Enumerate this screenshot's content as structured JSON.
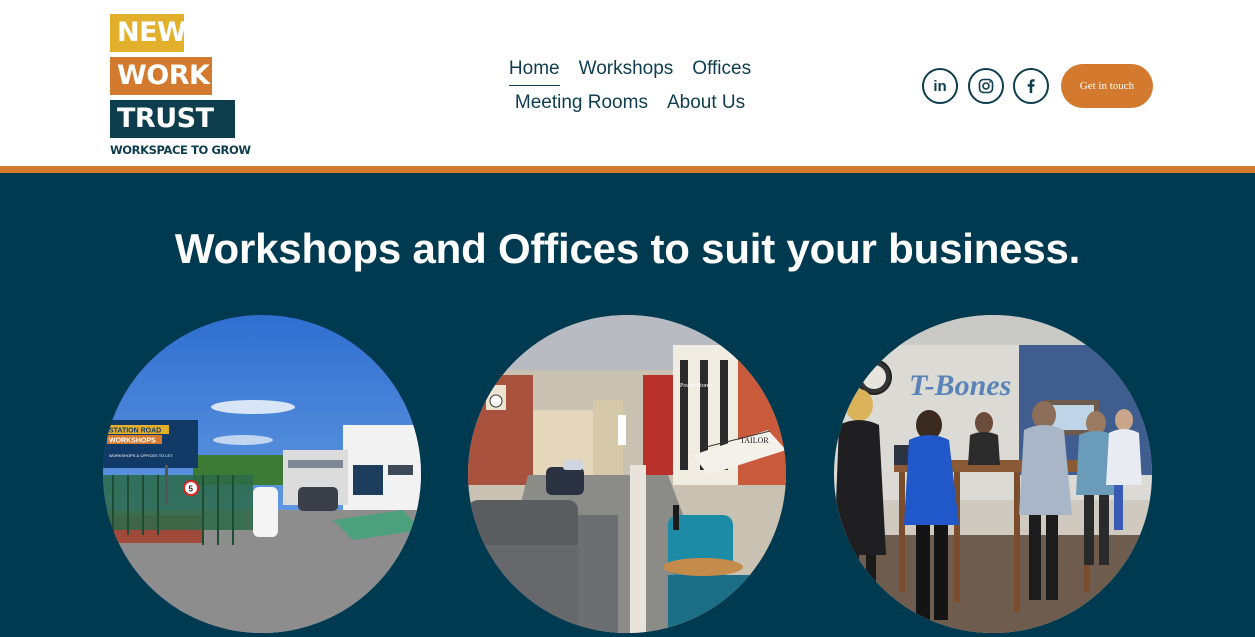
{
  "logo": {
    "line1": "NEW",
    "line2": "WORK",
    "line3": "TRUST",
    "tagline": "WORKSPACE TO GROW"
  },
  "nav": {
    "items": [
      {
        "label": "Home",
        "active": true
      },
      {
        "label": "Workshops"
      },
      {
        "label": "Offices"
      },
      {
        "label": "Meeting Rooms"
      },
      {
        "label": "About Us"
      }
    ]
  },
  "social": {
    "icons": [
      "linkedin-icon",
      "instagram-icon",
      "facebook-icon"
    ],
    "linkedin_text": "in"
  },
  "cta": {
    "label": "Get in touch"
  },
  "hero": {
    "heading": "Workshops and Offices to suit your business."
  },
  "photo1": {
    "sign_line1": "STATION ROAD",
    "sign_line2": "WORKSHOPS",
    "sign_line3": "WORKSHOPS & OFFICES TO LET",
    "speed": "5"
  },
  "photo2": {
    "shop1": "Pound Stores",
    "shop2": "TAILOR"
  },
  "photo3": {
    "mural": "T-Bones"
  },
  "colors": {
    "navy": "#003a50",
    "orange": "#d47a2e",
    "yellow": "#e3b02c",
    "dark_teal": "#0e3d4d"
  }
}
